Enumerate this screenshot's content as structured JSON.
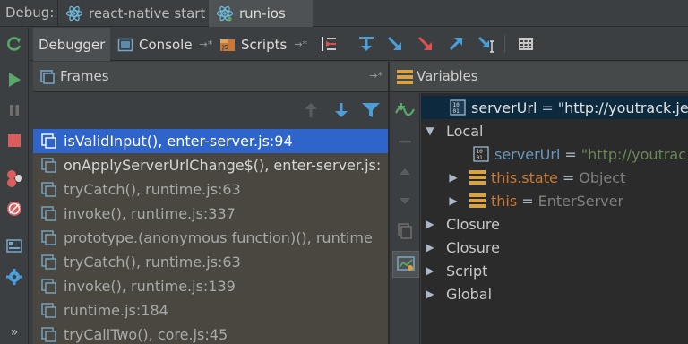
{
  "topbar": {
    "debug_label": "Debug:",
    "run_tabs": [
      {
        "label": "react-native start"
      },
      {
        "label": "run-ios"
      }
    ]
  },
  "panel_tabs": {
    "debugger": "Debugger",
    "console": "Console",
    "scripts": "Scripts",
    "pin_glyph": "→*"
  },
  "frames": {
    "title": "Frames",
    "pin_glyph": "→*",
    "items": [
      {
        "label": "isValidInput(), enter-server.js:94"
      },
      {
        "label": "onApplyServerUrlChange$(), enter-server.js:"
      },
      {
        "label": "tryCatch(), runtime.js:63"
      },
      {
        "label": "invoke(), runtime.js:337"
      },
      {
        "label": "prototype.(anonymous function)(), runtime"
      },
      {
        "label": "tryCatch(), runtime.js:63"
      },
      {
        "label": "invoke(), runtime.js:139"
      },
      {
        "label": "runtime.js:184"
      },
      {
        "label": "tryCallTwo(), core.js:45"
      }
    ]
  },
  "variables": {
    "title": "Variables",
    "watch": {
      "name": "serverUrl",
      "eq": "=",
      "value": "\"http://youtrack.je"
    },
    "tree": [
      {
        "label": "Local",
        "expanded": true
      },
      {
        "name": "serverUrl",
        "eq": "=",
        "value": "\"http://youtrac"
      },
      {
        "name": "this.state",
        "eq": "=",
        "value": "Object"
      },
      {
        "name": "this",
        "eq": "=",
        "value": "EnterServer"
      },
      {
        "label": "Closure"
      },
      {
        "label": "Closure"
      },
      {
        "label": "Script"
      },
      {
        "label": "Global"
      }
    ]
  },
  "glyphs": {
    "expanded": "▼",
    "collapsed": "▶"
  },
  "colors": {
    "selection": "#2f65ca",
    "frames_bg": "#49473f",
    "tree_bg": "#2b2b2b",
    "string": "#6a8759",
    "keyword": "#cc7832"
  }
}
